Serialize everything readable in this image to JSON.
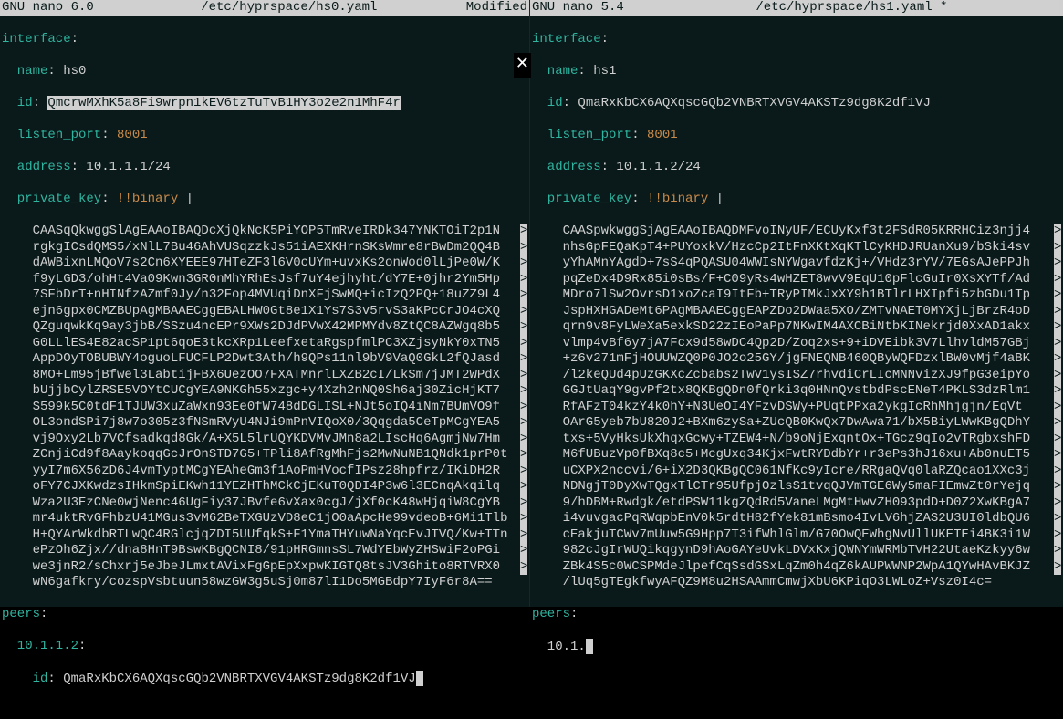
{
  "left": {
    "title_version": "GNU nano 6.0",
    "title_path": "/etc/hyprspace/hs0.yaml",
    "title_modified": "Modified",
    "interface_key": "interface",
    "name_key": "name",
    "name_val": "hs0",
    "id_key": "id",
    "id_val": "QmcrwMXhK5a8Fi9wrpn1kEV6tzTuTvB1HY3o2e2n1MhF4r",
    "listen_port_key": "listen_port",
    "listen_port_val": "8001",
    "address_key": "address",
    "address_val": "10.1.1.1/24",
    "private_key_key": "private_key",
    "binary_tag": "!!binary",
    "pipe": "|",
    "binkey": [
      "CAASqQkwggSlAgEAAoIBAQDcXjQkNcK5PiYOP5TmRveIRDk347YNKTOiT2p1N",
      "rgkgICsdQMS5/xNlL7Bu46AhVUSqzzkJs51iAEXKHrnSKsWmre8rBwDm2QQ4B",
      "dAWBixnLMQoV7s2Cn6XYEEE97HTeZF3l6V0cUYm+uvxKs2onWod0lLjPe0W/K",
      "f9yLGD3/ohHt4Va09Kwn3GR0nMhYRhEsJsf7uY4ejhyht/dY7E+0jhr2Ym5Hp",
      "7SFbDrT+nHINfzAZmf0Jy/n32Fop4MVUqiDnXFjSwMQ+icIzQ2PQ+18uZZ9L4",
      "ejn6gpx0CMZBUpAgMBAAECggEBALHW0Gt8e1X1Ys7S3v5rvS3aKPcCrJO4cXQ",
      "QZguqwkKq9ay3jbB/SSzu4ncEPr9XWs2DJdPVwX42MPMYdv8ZtQC8AZWgq8b5",
      "G0LLlES4E82acSP1pt6qoE3tkcXRp1LeefxetaRgspfmlPC3XZjsyNkY0xTN5",
      "AppDOyTOBUBWY4oguoLFUCFLP2Dwt3Ath/h9QPs11nl9bV9VaQ0GkL2fQJasd",
      "8MO+Lm95jBfwel3LabtijFBX6UezOO7FXATMnrlLXZB2cI/LkSm7jJMT2WPdX",
      "bUjjbCylZRSE5VOYtCUCgYEA9NKGh55xzgc+y4Xzh2nNQ0Sh6aj30ZicHjKT7",
      "S599k5C0tdF1TJUW3xuZaWxn93Ee0fW748dDGLISL+NJt5oIQ4iNm7BUmVO9f",
      "OL3ondSPi7j8w7o305z3fNSmRVyU4NJi9mPnVIQoX0/3Qqgda5CeTpMCgYEA5",
      "vj9Oxy2Lb7VCfsadkqd8Gk/A+X5L5lrUQYKDVMvJMn8a2LIscHq6AgmjNw7Hm",
      "ZCnjiCd9f8AaykoqqGcJrOnSTD7G5+TPli8AfRgMhFjs2MwNuNB1QNdk1prP0t",
      "yyI7m6X56zD6J4vmTyptMCgYEAheGm3f1AoPmHVocfIPsz28hpfrz/IKiDH2R",
      "oFY7CJXKwdzsIHkmSpiEKwh11YEZHThMCkCjEKuT0QDI4P3w6l3ECnqAkqilq",
      "Wza2U3EzCNe0wjNenc46UgFiy37JBvfe6vXax0cgJ/jXf0cK48wHjqiW8CgYB",
      "mr4uktRvGFhbzU41MGus3vM62BeTXGUzVD8eC1jO0aApcHe99vdeoB+6Mi1Tlb",
      "H+QYArWkdbRTLwQC4RGlcjqZDI5UUfqkS+F1YmaTHYuwNaYqcEvJTVQ/Kw+TTn",
      "ePzOh6Zjx//dna8HnT9BswKBgQCNI8/91pHRGmnsSL7WdYEbWyZHSwiF2oPGi",
      "we3jnR2/sChxrj5eJbeJLmxtAVixFgGpEpXxpwKIGTQ8tsJV3Ghito8RTVRX0",
      "wN6gafkry/cozspVsbtuun58wzGW3g5uSj0m87lI1Do5MGBdpY7IyF6r8A=="
    ],
    "peers_key": "peers",
    "peer_ip": "10.1.1.2",
    "peer_id_key": "id",
    "peer_id_val": "QmaRxKbCX6AQXqscGQb2VNBRTXVGV4AKSTz9dg8K2df1VJ"
  },
  "right": {
    "title_version": "GNU nano 5.4",
    "title_path": "/etc/hyprspace/hs1.yaml *",
    "title_modified": "",
    "interface_key": "interface",
    "name_key": "name",
    "name_val": "hs1",
    "id_key": "id",
    "id_val": "QmaRxKbCX6AQXqscGQb2VNBRTXVGV4AKSTz9dg8K2df1VJ",
    "listen_port_key": "listen_port",
    "listen_port_val": "8001",
    "address_key": "address",
    "address_val": "10.1.1.2/24",
    "private_key_key": "private_key",
    "binary_tag": "!!binary",
    "pipe": "|",
    "binkey": [
      "CAASpwkwggSjAgEAAoIBAQDMFvoINyUF/ECUyKxf3t2FSdR05KRRHCiz3njj4",
      "nhsGpFEQaKpT4+PUYoxkV/HzcCp2ItFnXKtXqKTlCyKHDJRUanXu9/bSki4sv",
      "yYhAMnYAgdD+7sS4qPQASU04WWIsNYWgavfdzKj+/VHdz3rYV/7EGsAJePPJh",
      "pqZeDx4D9Rx85i0sBs/F+C09yRs4wHZET8wvV9EqU10pFlcGuIr0XsXYTf/Ad",
      "MDro7lSw2OvrsD1xoZcaI9ItFb+TRyPIMkJxXY9h1BTlrLHXIpfi5zbGDu1Tp",
      "JspHXHGADeMt6PAgMBAAECggEAPZDo2DWaa5XO/ZMTvNAET0MYXjLjBrzR4oD",
      "qrn9v8FyLWeXa5exkSD22zIEoPaPp7NKwIM4AXCBiNtbKINekrjd0XxAD1akx",
      "vlmp4vBf6y7jA7Fcx9d58wDC4Qp2D/Zoq2xs+9+iDVEibk3V7LlhvldM57GBj",
      "+z6v271mFjHOUUWZQ0P0JO2o25GY/jgFNEQNB460QByWQFDzxlBW0vMjf4aBK",
      "/l2keQUd4pUzGKXcZcbabs2TwV1ysISZ7rhvdiCrLIcMNNvizXJ9fpG3eipYo",
      "GGJtUaqY9gvPf2tx8QKBgQDn0fQrki3q0HNnQvstbdPscENeT4PKLS3dzRlm1",
      "RfAFzT04kzY4k0hY+N3UeOI4YFzvDSWy+PUqtPPxa2ykgIcRhMhjgjn/EqVt",
      "OArG5yeb7bU820J2+BXm6zySa+ZUcQB0KwQx7DwAwa71/bX5BiyLWwKBgQDhY",
      "txs+5VyHksUkXhqxGcwy+TZEW4+N/b9oNjExqntOx+TGcz9qIo2vTRgbxshFD",
      "M6fUBuzVp0fBXq8c5+McgUxq34KjxFwtRYDdbYr+r3ePs3hJ16xu+Ab0nuET5",
      "uCXPX2nccvi/6+iX2D3QKBgQC061NfKc9yIcre/RRgaQVq0laRZQcao1XXc3j",
      "NDNgjT0DyXwTQgxTlCTr95UfpjOzlsS1tvqQJVmTGE6Wy5maFIEmwZt0rYejq",
      "9/hDBM+Rwdgk/etdPSW11kgZQdRd5VaneLMgMtHwvZH093pdD+D0Z2XwKBgA7",
      "i4vuvgacPqRWqpbEnV0k5rdtH82fYek81mBsmo4IvLV6hjZAS2U3UI0ldbQU6",
      "cEakjuTCWv7mUuw5G9Hpp7T3ifWhlGlm/G70OwQEWhgNvUllUKETEi4BK3i1W",
      "982cJgIrWUQikqgynD9hAoGAYeUvkLDVxKxjQWNYmWRMbTVH22UtaeKzkyy6w",
      "ZBk4S5c0WCSPMdeJlpefCqSsdGSxLqZm0h4qZ6kAUPWWNP2WpA1QYwHAvBKJZ",
      "/lUq5gTEgkfwyAFQZ9M8u2HSAAmmCmwjXbU6KPiqO3LWLoZ+Vsz0I4c="
    ],
    "peers_key": "peers",
    "peer_ip_partial": "10.1."
  }
}
